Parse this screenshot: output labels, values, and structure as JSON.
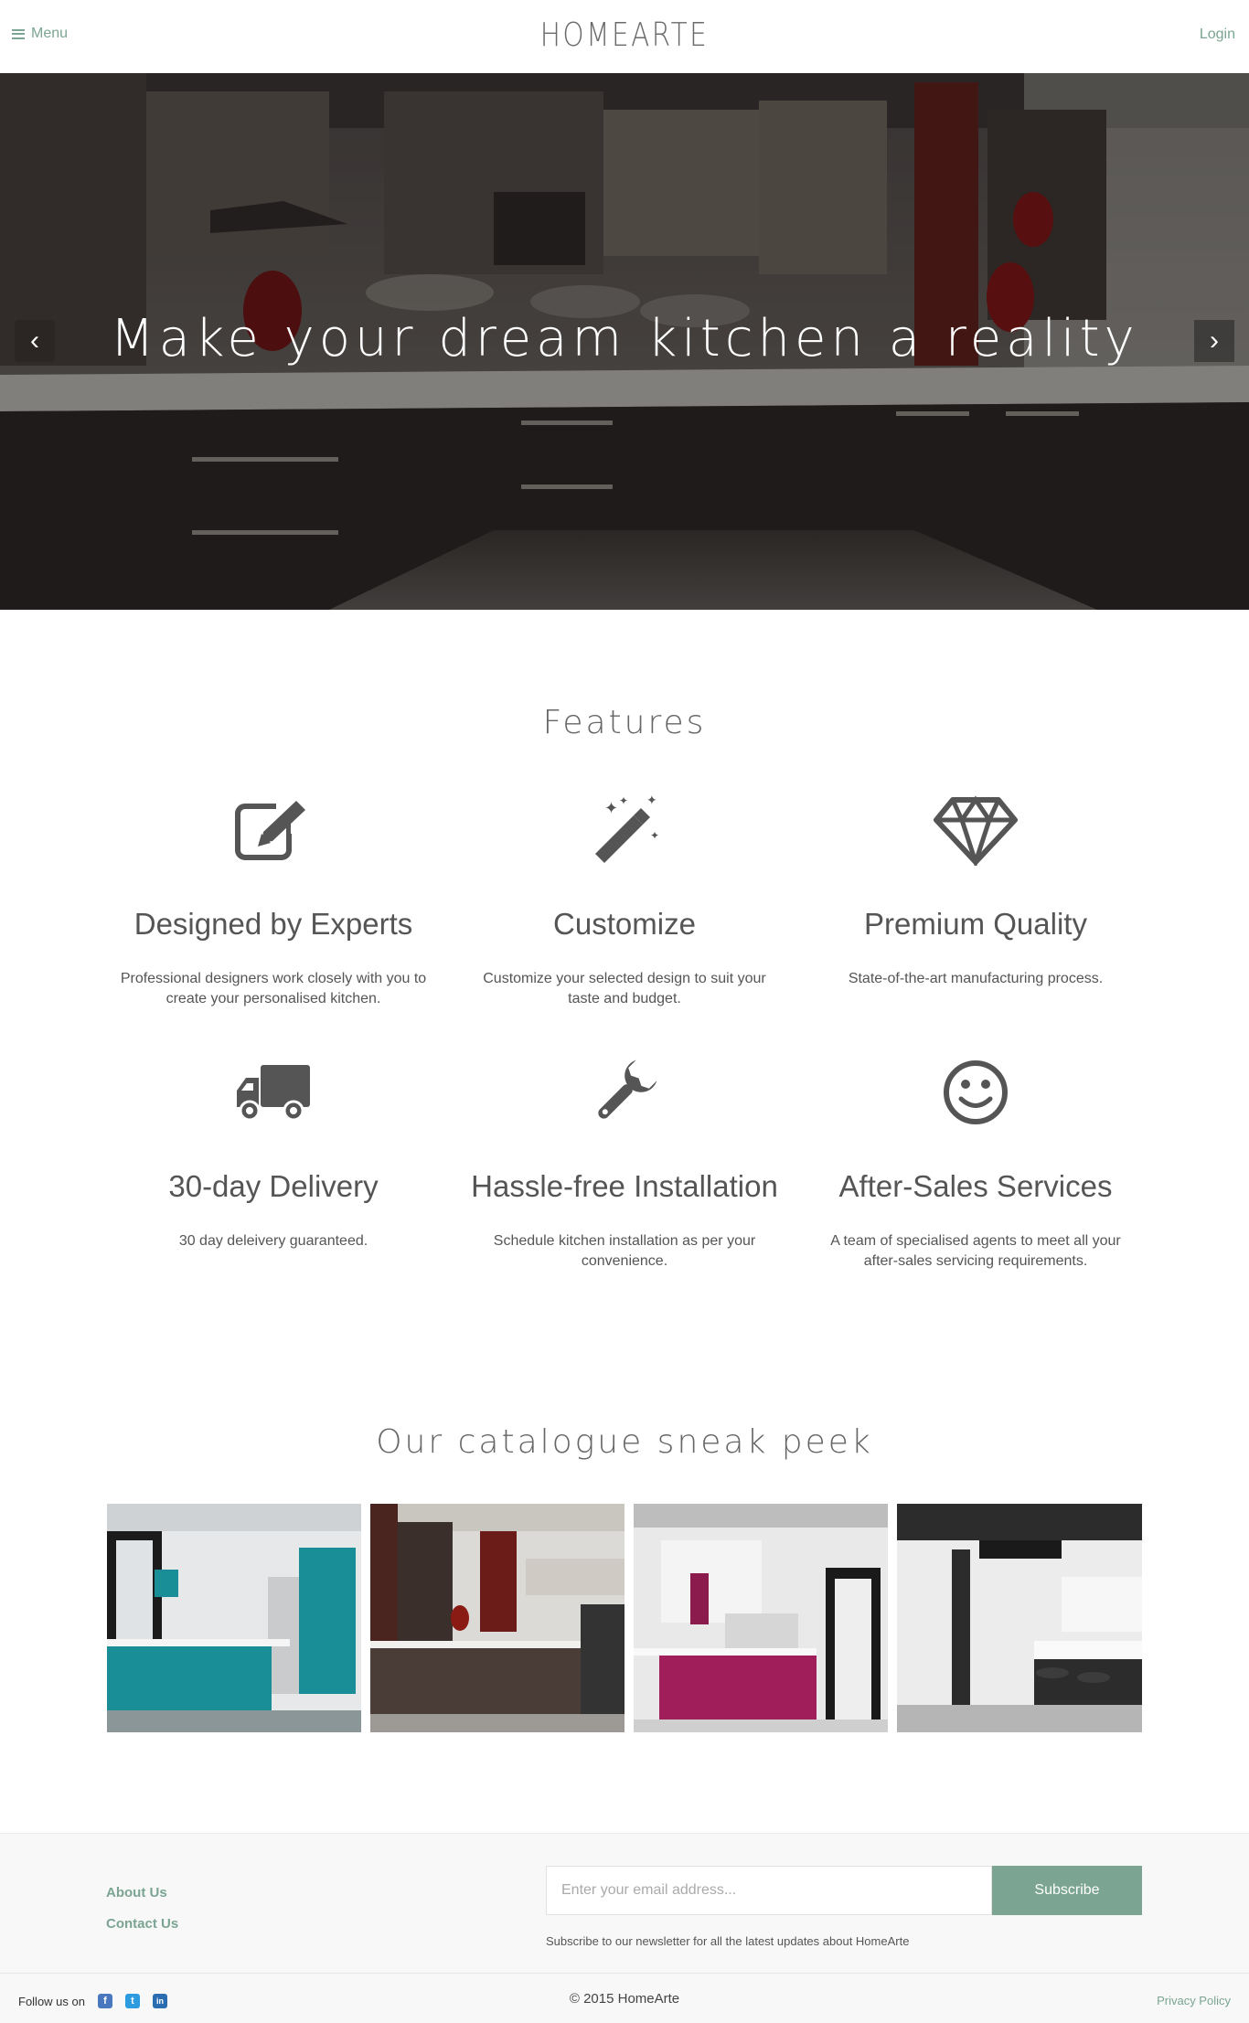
{
  "header": {
    "menu_label": "Menu",
    "brand": "HOMEARTE",
    "login_label": "Login"
  },
  "hero": {
    "title": "Make your dream kitchen a reality",
    "prev_arrow": "‹",
    "next_arrow": "›"
  },
  "features": {
    "title": "Features",
    "items": [
      {
        "icon": "edit-icon",
        "title": "Designed by Experts",
        "text": "Professional designers work closely with you to create your personalised kitchen."
      },
      {
        "icon": "magic-wand-icon",
        "title": "Customize",
        "text": "Customize your selected design to suit your taste and budget."
      },
      {
        "icon": "diamond-icon",
        "title": "Premium Quality",
        "text": "State-of-the-art manufacturing process."
      },
      {
        "icon": "truck-icon",
        "title": "30-day Delivery",
        "text": "30 day deleivery guaranteed."
      },
      {
        "icon": "wrench-icon",
        "title": "Hassle-free Installation",
        "text": "Schedule kitchen installation as per your convenience."
      },
      {
        "icon": "smiley-icon",
        "title": "After-Sales Services",
        "text": "A team of specialised agents to meet all your after-sales servicing requirements."
      }
    ]
  },
  "catalogue": {
    "title": "Our catalogue sneak peek",
    "items": [
      {
        "accent": "#1a8e96"
      },
      {
        "accent": "#4a3d38"
      },
      {
        "accent": "#a01e5a"
      },
      {
        "accent": "#2c2c2c"
      }
    ]
  },
  "footer": {
    "about_label": "About Us",
    "contact_label": "Contact Us",
    "email_placeholder": "Enter your email address...",
    "subscribe_label": "Subscribe",
    "newsletter_note": "Subscribe to our newsletter for all the latest updates about HomeArte",
    "follow_label": "Follow us on",
    "facebook_glyph": "f",
    "twitter_glyph": "t",
    "linkedin_glyph": "in",
    "copyright": "© 2015 HomeArte",
    "privacy_label": "Privacy Policy"
  },
  "colors": {
    "accent": "#7ba592",
    "icon": "#555555"
  }
}
